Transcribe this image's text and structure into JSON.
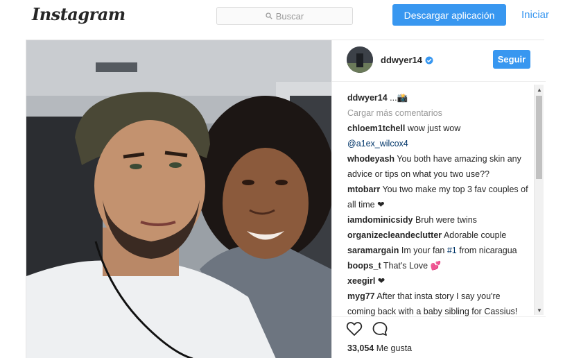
{
  "nav": {
    "logo": "Instagram",
    "search_placeholder": "Buscar",
    "download_label": "Descargar aplicación",
    "login_label": "Iniciar"
  },
  "post": {
    "username": "ddwyer14",
    "follow_label": "Seguir",
    "caption": "...📸",
    "load_more": "Cargar más comentarios",
    "comments": [
      {
        "user": "chloem1tchell",
        "text": "wow just wow",
        "mention": "@a1ex_wilcox4",
        "after": ""
      },
      {
        "user": "whodeyash",
        "text": "You both have amazing skin any advice or tips on what you two use??",
        "mention": "",
        "after": ""
      },
      {
        "user": "mtobarr",
        "text": "You two make my top 3 fav couples of all time ❤",
        "mention": "",
        "after": ""
      },
      {
        "user": "iamdominicsidy",
        "text": "Bruh were twins",
        "mention": "",
        "after": ""
      },
      {
        "user": "organizecleandeclutter",
        "text": "Adorable couple",
        "mention": "",
        "after": ""
      },
      {
        "user": "saramargain",
        "text": "Im your fan",
        "mention": "#1",
        "after": "from nicaragua"
      },
      {
        "user": "boops_t",
        "text": "That's Love 💕",
        "mention": "",
        "after": ""
      },
      {
        "user": "xeegirl",
        "text": "❤",
        "mention": "",
        "after": ""
      },
      {
        "user": "myg77",
        "text": "After that insta story I say you're coming back with a baby sibling for Cassius! 😄",
        "mention": "",
        "after": ""
      }
    ],
    "likes_count": "33,054",
    "likes_label": "Me gusta"
  },
  "colors": {
    "accent": "#3897f0",
    "link": "#003569",
    "text": "#262626",
    "muted": "#999999"
  },
  "icons": [
    "search-icon",
    "verified-icon",
    "heart-icon",
    "comment-icon"
  ]
}
